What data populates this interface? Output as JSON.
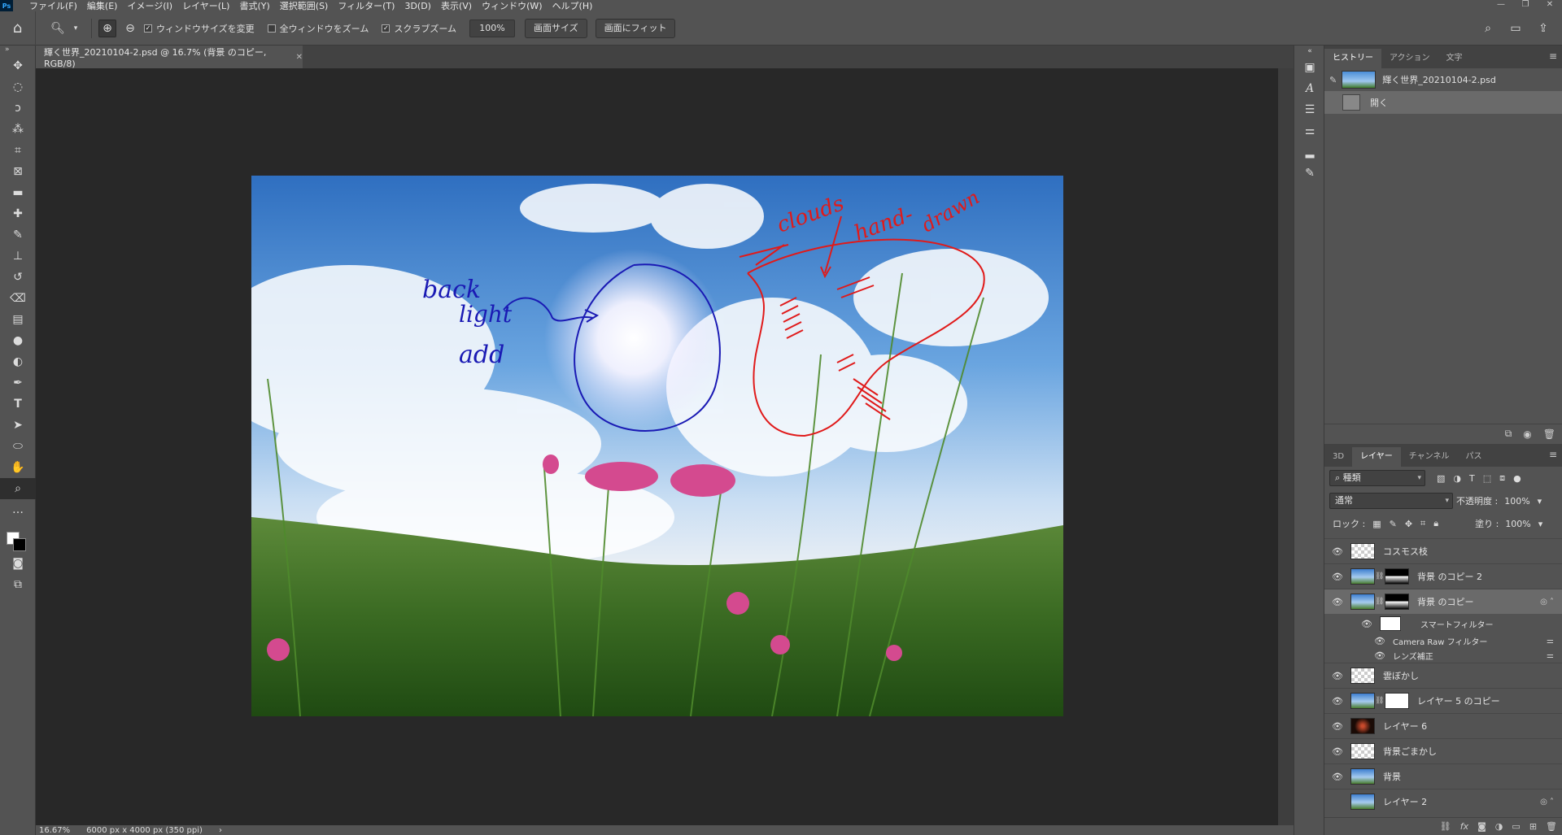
{
  "menubar": {
    "logo": "Ps",
    "items": [
      "ファイル(F)",
      "編集(E)",
      "イメージ(I)",
      "レイヤー(L)",
      "書式(Y)",
      "選択範囲(S)",
      "フィルター(T)",
      "3D(D)",
      "表示(V)",
      "ウィンドウ(W)",
      "ヘルプ(H)"
    ],
    "window_controls": [
      "—",
      "❐",
      "✕"
    ]
  },
  "options": {
    "resize_windows_label": "ウィンドウサイズを変更",
    "zoom_all_label": "全ウィンドウをズーム",
    "scrubby_zoom_label": "スクラブズーム",
    "zoom_value": "100%",
    "fit_screen_button": "画面サイズ",
    "fill_screen_button": "画面にフィット"
  },
  "document": {
    "tab_title": "輝く世界_20210104-2.psd @ 16.7% (背景 のコピー, RGB/8)",
    "annotations": {
      "blue_line1": "back",
      "blue_line2": "light",
      "blue_line3": "add",
      "red_word1": "clouds",
      "red_word2": "hand-",
      "red_word3": "drawn"
    }
  },
  "status": {
    "zoom": "16.67%",
    "dimensions": "6000 px x 4000 px (350 ppi)"
  },
  "history_panel": {
    "tabs": [
      "ヒストリー",
      "アクション",
      "文字"
    ],
    "snapshot_name": "輝く世界_20210104-2.psd",
    "states": [
      "開く"
    ]
  },
  "layers_panel": {
    "tabs": [
      "3D",
      "レイヤー",
      "チャンネル",
      "パス"
    ],
    "filter_kind": "種類",
    "blend_mode": "通常",
    "opacity_label": "不透明度 :",
    "opacity_value": "100%",
    "lock_label": "ロック :",
    "fill_label": "塗り :",
    "fill_value": "100%",
    "layers": [
      {
        "name": "コスモス枝"
      },
      {
        "name": "背景 のコピー 2"
      },
      {
        "name": "背景 のコピー"
      },
      {
        "name": "雲ぼかし"
      },
      {
        "name": "レイヤー 5 のコピー"
      },
      {
        "name": "レイヤー 6"
      },
      {
        "name": "背景ごまかし"
      },
      {
        "name": "背景"
      },
      {
        "name": "レイヤー 2"
      }
    ],
    "smart_filters": {
      "label": "スマートフィルター",
      "items": [
        "Camera Raw フィルター",
        "レンズ補正"
      ]
    }
  },
  "colors": {
    "annotation_blue": "#1a1ab4",
    "annotation_red": "#e01a1a",
    "ui_panel": "#535353",
    "ui_dark": "#282828"
  }
}
